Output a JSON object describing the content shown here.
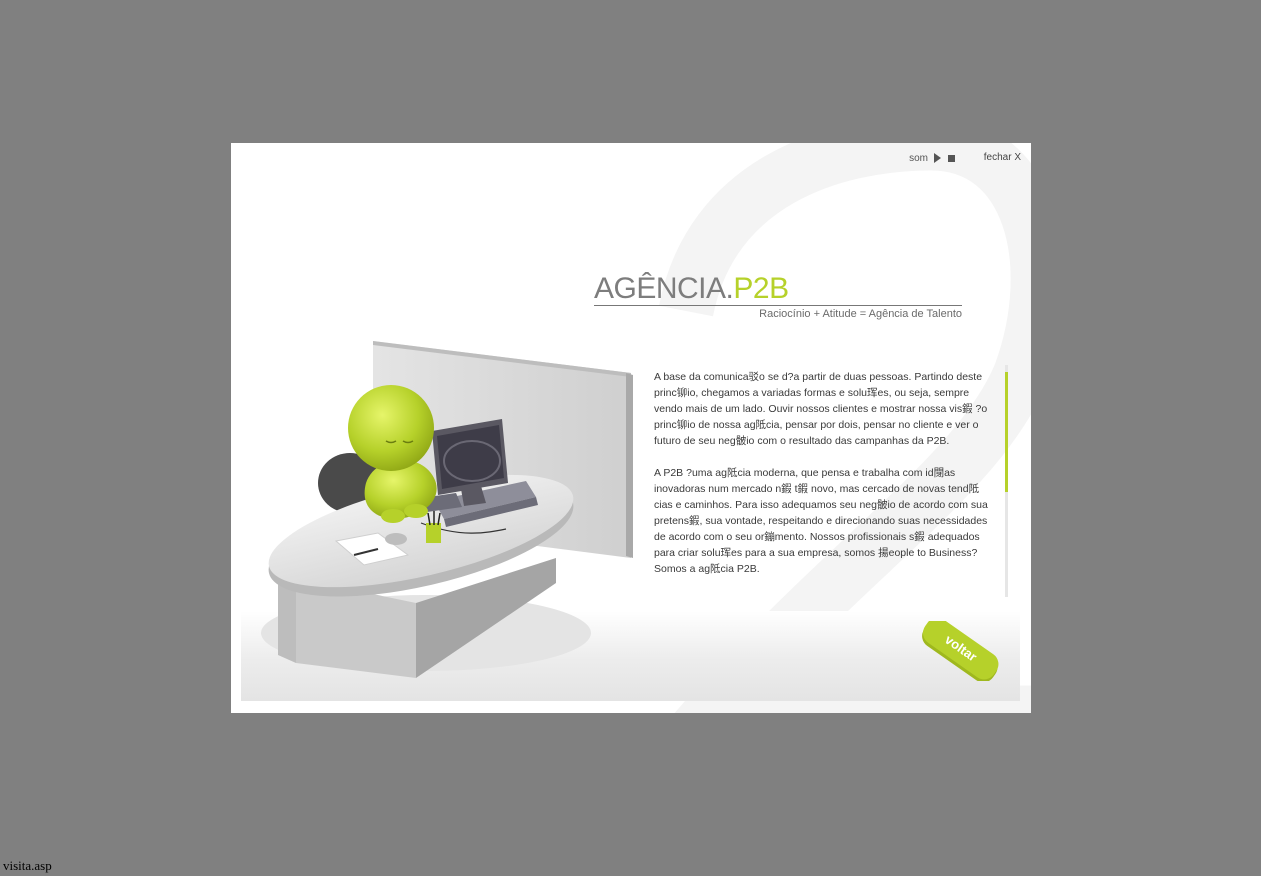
{
  "topbar": {
    "sound_label": "som",
    "close_label": "fechar X"
  },
  "brand": {
    "name_part1": "AGÊNCIA.",
    "name_part2": "P2B",
    "tagline": "Raciocínio + Atitude = Agência de Talento",
    "accent_color": "#b6d12a"
  },
  "content": {
    "paragraphs": [
      "A base da comunica驳o se d?a partir de duas pessoas. Partindo deste princ铆io, chegamos a variadas formas e solu珲es, ou seja, sempre vendo mais de um lado. Ouvir nossos clientes e mostrar nossa vis鍜 ?o princ铆io de nossa ag阺cia, pensar por dois, pensar no cliente e ver o futuro de seu neg骳io com o resultado das campanhas da P2B.",
      "A P2B ?uma ag阺cia moderna, que pensa e trabalha com id閕as inovadoras num mercado n鍜 t鍜 novo, mas cercado de novas tend阺cias e caminhos. Para isso adequamos seu neg骳io de acordo com sua pretens鍜, sua vontade, respeitando e direcionando suas necessidades de acordo com o seu or鏰mento. Nossos profissionais s鍜 adequados para criar solu珲es para a sua empresa, somos 揚eople to Business? Somos a ag阺cia P2B."
    ],
    "scroll_progress": 0.06
  },
  "back_button": {
    "label": "voltar"
  },
  "status_bar": {
    "text": "visita.asp"
  }
}
